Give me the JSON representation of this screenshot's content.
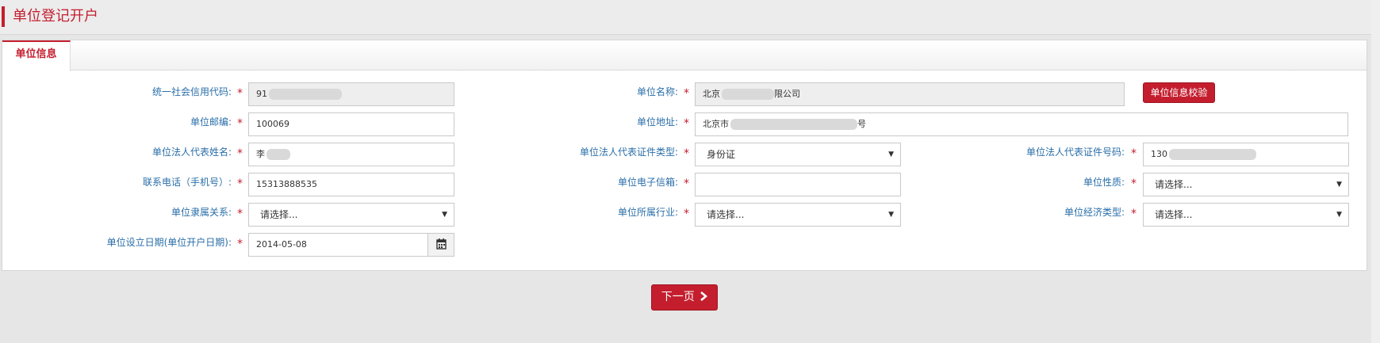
{
  "page": {
    "title": "单位登记开户"
  },
  "tabs": [
    {
      "label": "单位信息",
      "active": true
    }
  ],
  "form": {
    "credit_code": {
      "label": "统一社会信用代码:",
      "value": "91"
    },
    "unit_name": {
      "label": "单位名称:",
      "value_prefix": "北京",
      "value_suffix": "限公司"
    },
    "verify_button": {
      "label": "单位信息校验"
    },
    "postal_code": {
      "label": "单位邮编:",
      "value": "100069"
    },
    "address": {
      "label": "单位地址:",
      "value_prefix": "北京市",
      "value_suffix": "号"
    },
    "legal_rep_name": {
      "label": "单位法人代表姓名:",
      "value": "李"
    },
    "legal_rep_id_type": {
      "label": "单位法人代表证件类型:",
      "value": "身份证"
    },
    "legal_rep_id_no": {
      "label": "单位法人代表证件号码:",
      "value": "130"
    },
    "phone": {
      "label": "联系电话（手机号）:",
      "value": "15313888535"
    },
    "email": {
      "label": "单位电子信箱:",
      "value": ""
    },
    "unit_nature": {
      "label": "单位性质:",
      "value": "请选择..."
    },
    "affiliation": {
      "label": "单位隶属关系:",
      "value": "请选择..."
    },
    "industry": {
      "label": "单位所属行业:",
      "value": "请选择..."
    },
    "economic_type": {
      "label": "单位经济类型:",
      "value": "请选择..."
    },
    "establish_date": {
      "label": "单位设立日期(单位开户日期):",
      "value": "2014-05-08"
    },
    "required_mark": "*"
  },
  "next_button": {
    "label": "下一页"
  },
  "colors": {
    "accent": "#c41e2e",
    "label": "#2a6ea8"
  }
}
